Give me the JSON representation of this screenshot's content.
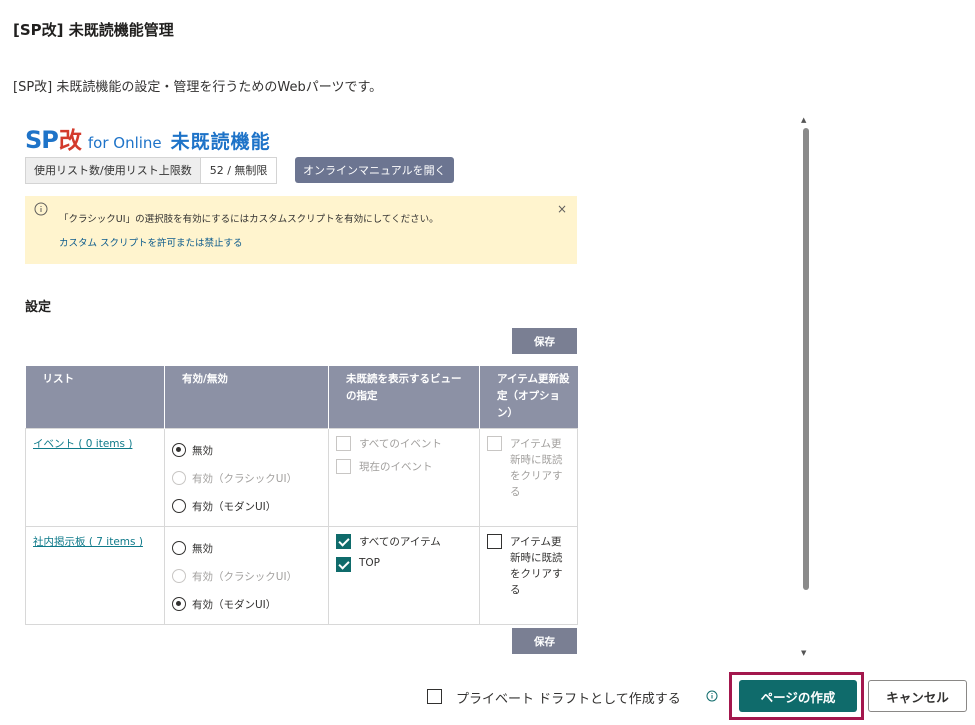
{
  "dialog": {
    "title": "[SP改] 未既読機能管理",
    "description": "[SP改] 未既読機能の設定・管理を行うためのWebパーツです。"
  },
  "webpart": {
    "logo": {
      "sp": "SP",
      "kai": "改",
      "online": "for Online",
      "name": "未既読機能"
    },
    "usage": {
      "label": "使用リスト数/使用リスト上限数",
      "value": "52 / 無制限"
    },
    "manual_button": "オンラインマニュアルを開く",
    "message": {
      "text": "「クラシックUI」の選択肢を有効にするにはカスタムスクリプトを有効にしてください。",
      "link": "カスタム スクリプトを許可または禁止する",
      "close": "×"
    },
    "settings_heading": "設定",
    "save_label": "保存",
    "table": {
      "headers": [
        "リスト",
        "有効/無効",
        "未既読を表示するビューの指定",
        "アイテム更新設定（オプション）"
      ],
      "rows": [
        {
          "list": "イベント ( 0 items )",
          "options": [
            {
              "label": "無効",
              "selected": true,
              "disabled": false
            },
            {
              "label": "有効（クラシックUI）",
              "selected": false,
              "disabled": true
            },
            {
              "label": "有効（モダンUI）",
              "selected": false,
              "disabled": false
            }
          ],
          "views": [
            {
              "label": "すべてのイベント",
              "checked": false,
              "disabled": true
            },
            {
              "label": "現在のイベント",
              "checked": false,
              "disabled": true
            }
          ],
          "update": {
            "label": "アイテム更新時に既読をクリアする",
            "checked": false,
            "disabled": true
          }
        },
        {
          "list": "社内掲示板 ( 7 items )",
          "options": [
            {
              "label": "無効",
              "selected": false,
              "disabled": false
            },
            {
              "label": "有効（クラシックUI）",
              "selected": false,
              "disabled": true
            },
            {
              "label": "有効（モダンUI）",
              "selected": true,
              "disabled": false
            }
          ],
          "views": [
            {
              "label": "すべてのアイテム",
              "checked": true,
              "disabled": false
            },
            {
              "label": "TOP",
              "checked": true,
              "disabled": false
            }
          ],
          "update": {
            "label": "アイテム更新時に既読をクリアする",
            "checked": false,
            "disabled": false
          }
        }
      ]
    }
  },
  "footer": {
    "private_draft_label": "プライベート ドラフトとして作成する",
    "create_label": "ページの作成",
    "cancel_label": "キャンセル"
  },
  "colors": {
    "primary": "#0f6b6b",
    "highlight": "#a3174d",
    "header": "#8c91a5",
    "message_bg": "#fff4ce"
  }
}
